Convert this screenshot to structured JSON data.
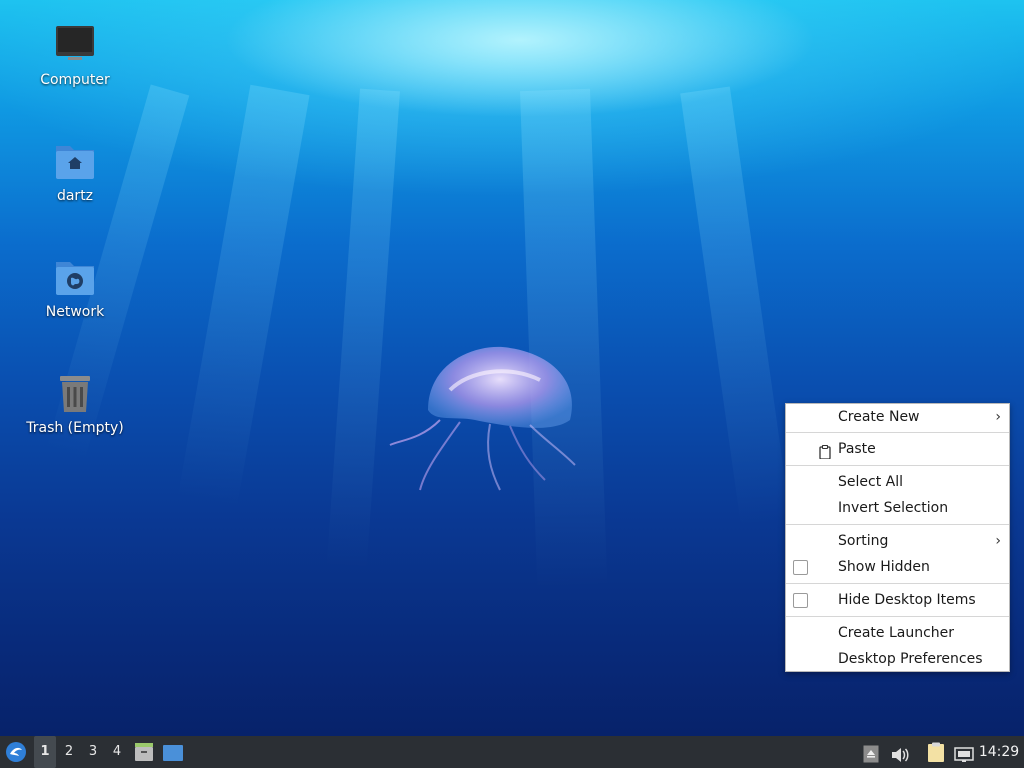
{
  "desktop": {
    "icons": [
      {
        "label": "Computer",
        "icon": "computer-icon"
      },
      {
        "label": "dartz",
        "icon": "home-folder-icon"
      },
      {
        "label": "Network",
        "icon": "network-folder-icon"
      },
      {
        "label": "Trash (Empty)",
        "icon": "trash-icon"
      }
    ]
  },
  "context_menu": {
    "items": {
      "create_new": "Create New",
      "paste": "Paste",
      "select_all": "Select All",
      "invert_selection": "Invert Selection",
      "sorting": "Sorting",
      "show_hidden": "Show Hidden",
      "hide_desktop_items": "Hide Desktop Items",
      "create_launcher": "Create Launcher",
      "desktop_preferences": "Desktop Preferences"
    },
    "submenu_arrow": "›",
    "show_hidden_checked": false,
    "hide_desktop_items_checked": false
  },
  "taskbar": {
    "workspaces": [
      "1",
      "2",
      "3",
      "4"
    ],
    "active_workspace": "1",
    "clock": "14:29",
    "tray_icons": [
      "eject-icon",
      "volume-icon",
      "clipboard-icon",
      "network-icon"
    ]
  },
  "colors": {
    "taskbar_bg": "#2b2f34",
    "menu_bg": "#ffffff",
    "accent": "#4a90d9"
  }
}
